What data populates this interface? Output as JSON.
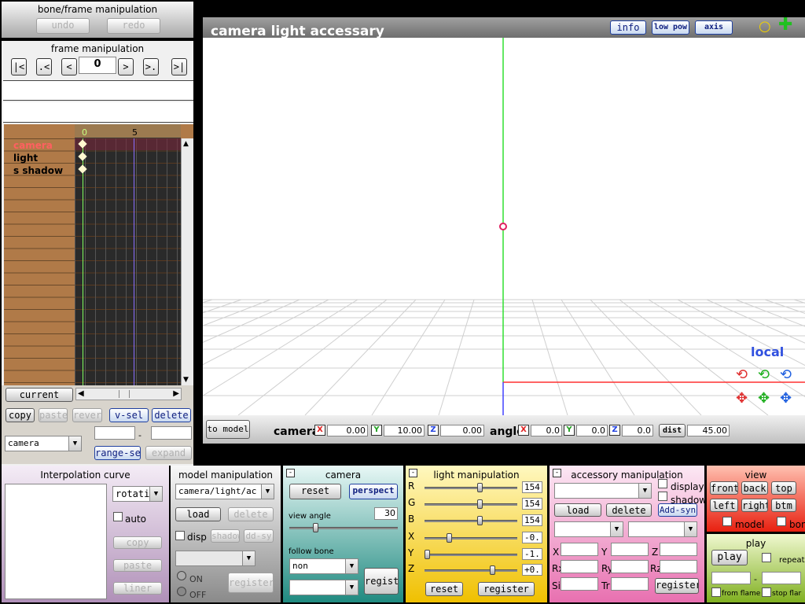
{
  "bone_frame": {
    "title": "bone/frame manipulation",
    "undo": "undo",
    "redo": "redo"
  },
  "frame_manip": {
    "title": "frame manipulation",
    "frame": "0",
    "nav": [
      "|<",
      ".<",
      "<",
      ">",
      ">.",
      ">|"
    ]
  },
  "timeline": {
    "tick0": "0",
    "tick5": "5",
    "rows": [
      "camera",
      "light",
      "s shadow"
    ]
  },
  "left_buttons": {
    "current": "current",
    "copy": "copy",
    "paste": "paste",
    "reverse": "revers",
    "vsel": "v-sel",
    "delete": "delete",
    "target": "camera",
    "range_sel": "range-se.",
    "expand": "expand",
    "range_sep": "-"
  },
  "viewport": {
    "title": "camera light accessary",
    "info": "info",
    "low_pow": "low pow",
    "axis": "axis",
    "local": "local"
  },
  "camera_bar": {
    "to_model": "to model",
    "camera_label": "camera",
    "x_btn": "X",
    "y_btn": "Y",
    "z_btn": "Z",
    "cam_x": "0.00",
    "cam_y": "10.00",
    "cam_z": "0.00",
    "angle_label": "angle",
    "ang_x": "0.0",
    "ang_y": "0.0",
    "ang_z": "0.0",
    "dist_btn": "dist",
    "dist": "45.00"
  },
  "interp": {
    "title": "Interpolation curve",
    "mode": "rotati",
    "auto": "auto",
    "copy": "copy",
    "paste": "paste",
    "liner": "liner"
  },
  "model_manip": {
    "title": "model manipulation",
    "model": "camera/light/ac",
    "load": "load",
    "delete": "delete",
    "disp": "disp",
    "shadow": "shadow",
    "add_sy": "dd-sy",
    "on": "ON",
    "off": "OFF",
    "register": "register"
  },
  "camera_panel": {
    "title": "camera",
    "reset": "reset",
    "perspect": "perspect",
    "view_angle_label": "view angle",
    "view_angle": "30",
    "follow_bone": "follow bone",
    "follow": "non",
    "register": "registe"
  },
  "light_panel": {
    "title": "light manipulation",
    "labels": [
      "R",
      "G",
      "B",
      "X",
      "Y",
      "Z"
    ],
    "values": [
      "154",
      "154",
      "154",
      "-0.",
      "-1.",
      "+0."
    ],
    "levels": [
      0.6,
      0.6,
      0.6,
      0.25,
      0.0,
      0.75
    ],
    "reset": "reset",
    "register": "register"
  },
  "accessory": {
    "title": "accessory manipulation",
    "display": "display",
    "shadow": "shadow",
    "load": "load",
    "delete": "delete",
    "add_syn": "Add-syn",
    "x": "X",
    "y": "Y",
    "z": "Z",
    "rx": "Rx",
    "ry": "Ry",
    "rz": "Rz",
    "si": "Si",
    "tr": "Tr",
    "register": "register"
  },
  "view_panel": {
    "title": "view",
    "front": "front",
    "back": "back",
    "top": "top",
    "left": "left",
    "right": "right",
    "btm": "btm",
    "model": "model",
    "bone": "bon"
  },
  "play_panel": {
    "title": "play",
    "play": "play",
    "repeat": "repeat",
    "from_flame": "from flame",
    "stop_flame": "stop flar",
    "sep": "-"
  }
}
